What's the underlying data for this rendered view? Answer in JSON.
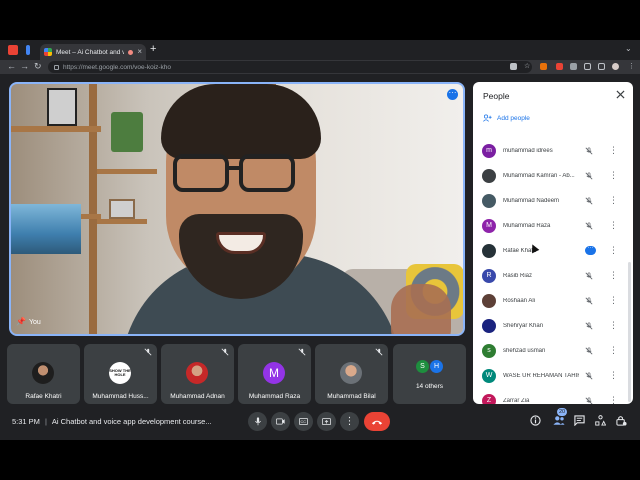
{
  "browser": {
    "tab_title": "Meet – Ai Chatbot and voic",
    "url": "https://meet.google.com/voe-koiz-kho",
    "new_tab_symbol": "+"
  },
  "meeting": {
    "time": "5:31 PM",
    "separator": "|",
    "title": "Ai Chatbot and voice app development course...",
    "self_label": "You",
    "participant_count": "20"
  },
  "tiles": [
    {
      "name": "Rafae Khatri",
      "avatar": "photo",
      "muted": false
    },
    {
      "name": "Muhammad Huss...",
      "avatar": "logo",
      "muted": true
    },
    {
      "name": "Muhammad Adnan",
      "avatar": "photo",
      "muted": true
    },
    {
      "name": "Muhammad Raza",
      "avatar": "letter",
      "letter": "M",
      "muted": true
    },
    {
      "name": "Muhammad Bilal",
      "avatar": "photo",
      "muted": true
    }
  ],
  "others": {
    "label": "14 others",
    "avatars": [
      {
        "letter": "S",
        "color": "#1e8e3e"
      },
      {
        "letter": "H",
        "color": "#1a73e8"
      }
    ]
  },
  "tile_logo_text": "SHOW THE HOLE",
  "people_panel": {
    "title": "People",
    "add_people": "Add people",
    "participants": [
      {
        "name": "muhammad idrees",
        "letter": "m",
        "color": "#7b1fa2",
        "state": "muted"
      },
      {
        "name": "Muhammad Kamran - Ab...",
        "letter": "",
        "color": "#3c4043",
        "state": "muted"
      },
      {
        "name": "Muhammad Nadeem",
        "letter": "",
        "color": "#455a64",
        "state": "muted"
      },
      {
        "name": "Muhammad Raza",
        "letter": "M",
        "color": "#8e24aa",
        "state": "muted"
      },
      {
        "name": "Rafae Khatri",
        "letter": "",
        "color": "#263238",
        "state": "speaking"
      },
      {
        "name": "Rasib Riaz",
        "letter": "R",
        "color": "#3949ab",
        "state": "muted"
      },
      {
        "name": "Roshaan Ali",
        "letter": "",
        "color": "#5d4037",
        "state": "muted"
      },
      {
        "name": "Shehryar Khan",
        "letter": "",
        "color": "#1a237e",
        "state": "muted"
      },
      {
        "name": "shehzad usman",
        "letter": "s",
        "color": "#2e7d32",
        "state": "muted"
      },
      {
        "name": "WASE UR REHAMAN TAHIRI",
        "letter": "W",
        "color": "#00897b",
        "state": "muted"
      },
      {
        "name": "Zarrar Zia",
        "letter": "Z",
        "color": "#c2185b",
        "state": "muted"
      }
    ]
  },
  "colors": {
    "accent": "#1a73e8",
    "hangup": "#ea4335",
    "highlight": "#8ab4f8",
    "background": "#202124"
  },
  "icons": [
    "mic-icon",
    "camera-icon",
    "captions-icon",
    "present-icon",
    "more-vert-icon",
    "hang-up-icon",
    "info-icon",
    "people-icon",
    "chat-icon",
    "activities-icon",
    "host-controls-icon"
  ]
}
